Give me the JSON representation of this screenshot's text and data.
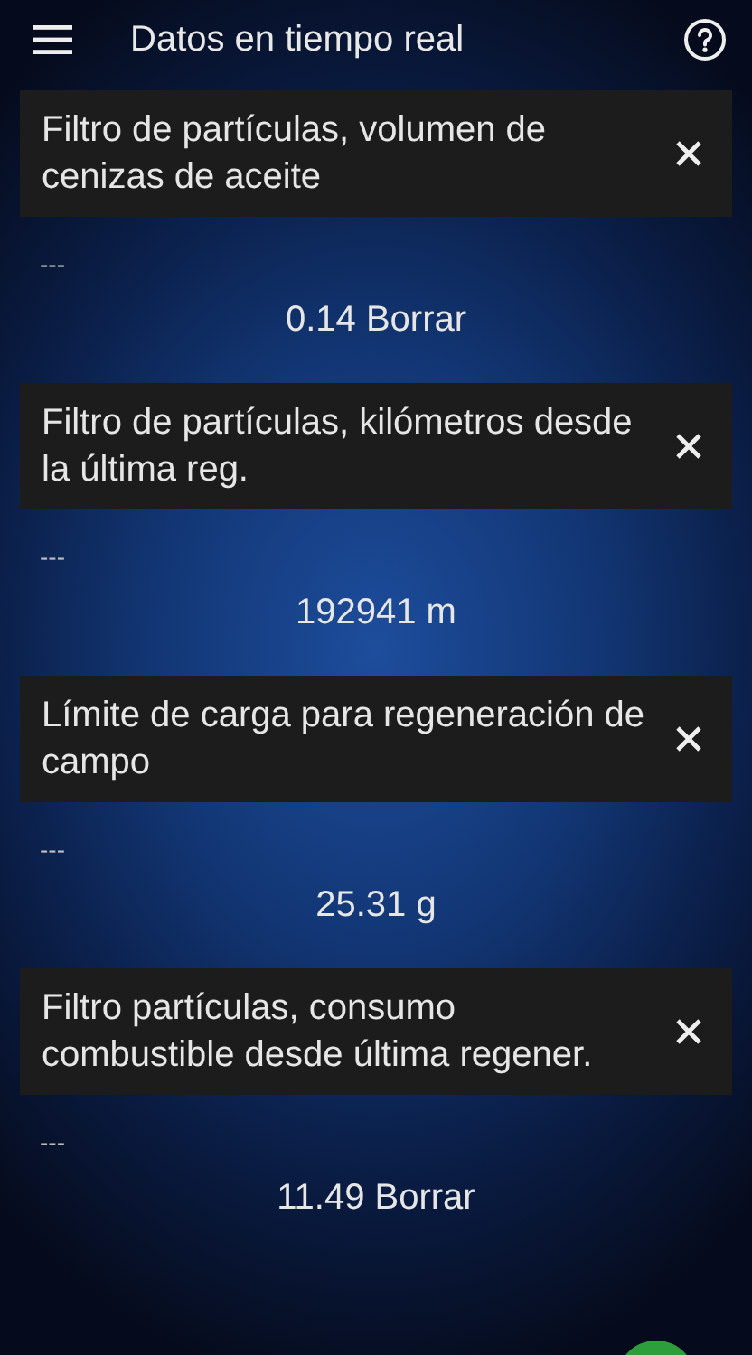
{
  "app_bar": {
    "title": "Datos en tiempo real"
  },
  "items": [
    {
      "title": "Filtro de partículas, volumen de cenizas de aceite",
      "placeholder_value": "---",
      "value": "0.14 Borrar"
    },
    {
      "title": "Filtro de partículas, kilómetros desde la última reg.",
      "placeholder_value": "---",
      "value": "192941 m"
    },
    {
      "title": "Límite de carga para regeneración de campo",
      "placeholder_value": "---",
      "value": "25.31 g"
    },
    {
      "title": "Filtro partículas, consumo combustible desde última regener.",
      "placeholder_value": "---",
      "value": "11.49 Borrar"
    }
  ]
}
